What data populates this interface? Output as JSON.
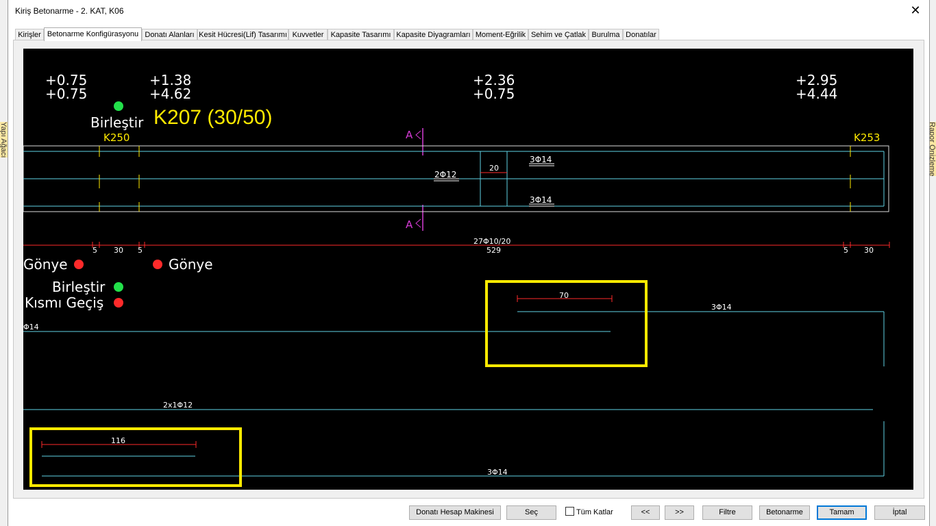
{
  "window": {
    "title": "Kiriş Betonarme - 2. KAT, K06",
    "close_glyph": "✕"
  },
  "side": {
    "left_label": "Yapı Ağacı",
    "right_label": "Rapor Önizleme"
  },
  "tabs": [
    {
      "label": "Kirişler",
      "active": false
    },
    {
      "label": "Betonarme Konfigürasyonu",
      "active": true
    },
    {
      "label": "Donatı Alanları",
      "active": false
    },
    {
      "label": "Kesit Hücresi(Lif) Tasarımı",
      "active": false
    },
    {
      "label": "Kuvvetler",
      "active": false
    },
    {
      "label": "Kapasite Tasarımı",
      "active": false
    },
    {
      "label": "Kapasite Diyagramları",
      "active": false
    },
    {
      "label": "Moment-Eğrilik",
      "active": false
    },
    {
      "label": "Sehim ve Çatlak",
      "active": false
    },
    {
      "label": "Burulma",
      "active": false
    },
    {
      "label": "Donatılar",
      "active": false
    }
  ],
  "drawing": {
    "elev_1": {
      "top": "+0.75",
      "bottom": "+0.75"
    },
    "elev_2": {
      "top": "+1.38",
      "bottom": "+4.62"
    },
    "elev_3": {
      "top": "+2.36",
      "bottom": "+0.75"
    },
    "elev_4": {
      "top": "+2.95",
      "bottom": "+4.44"
    },
    "beam_title": "K207 (30/50)",
    "support_left": "K250",
    "support_right": "K253",
    "birlestir_top": "Birleştir",
    "section_mark": "A",
    "rebar_mid_left": "2Φ12",
    "rebar_top": "3Φ14",
    "rebar_bottom": "3Φ14",
    "dim_20": "20",
    "stirrup_label": "27Φ10/20",
    "span_length": "529",
    "dim_left": [
      "5",
      "30",
      "5"
    ],
    "dim_right": [
      "5",
      "30"
    ],
    "gonye_left": "Gönye",
    "gonye_right": "Gönye",
    "birlestir": "Birleştir",
    "kismi_gecis": "Kısmı Geçiş",
    "bar_top_left": "Φ14",
    "bar_top_right": "3Φ14",
    "overlap_top": "70",
    "bar_mid": "2x1Φ12",
    "overlap_bottom": "116",
    "bar_bottom": "3Φ14",
    "colors": {
      "cyan": "#5fd3e6",
      "yellow": "#ffea00",
      "red": "#ff2a2a",
      "green": "#22e04a",
      "magenta": "#d63cd6",
      "white": "#ffffff"
    }
  },
  "buttons": {
    "calc": "Donatı Hesap Makinesi",
    "sec": "Seç",
    "tum_katlar": "Tüm Katlar",
    "prev": "<<",
    "next": ">>",
    "filtre": "Filtre",
    "betonarme": "Betonarme",
    "tamam": "Tamam",
    "iptal": "İptal"
  }
}
